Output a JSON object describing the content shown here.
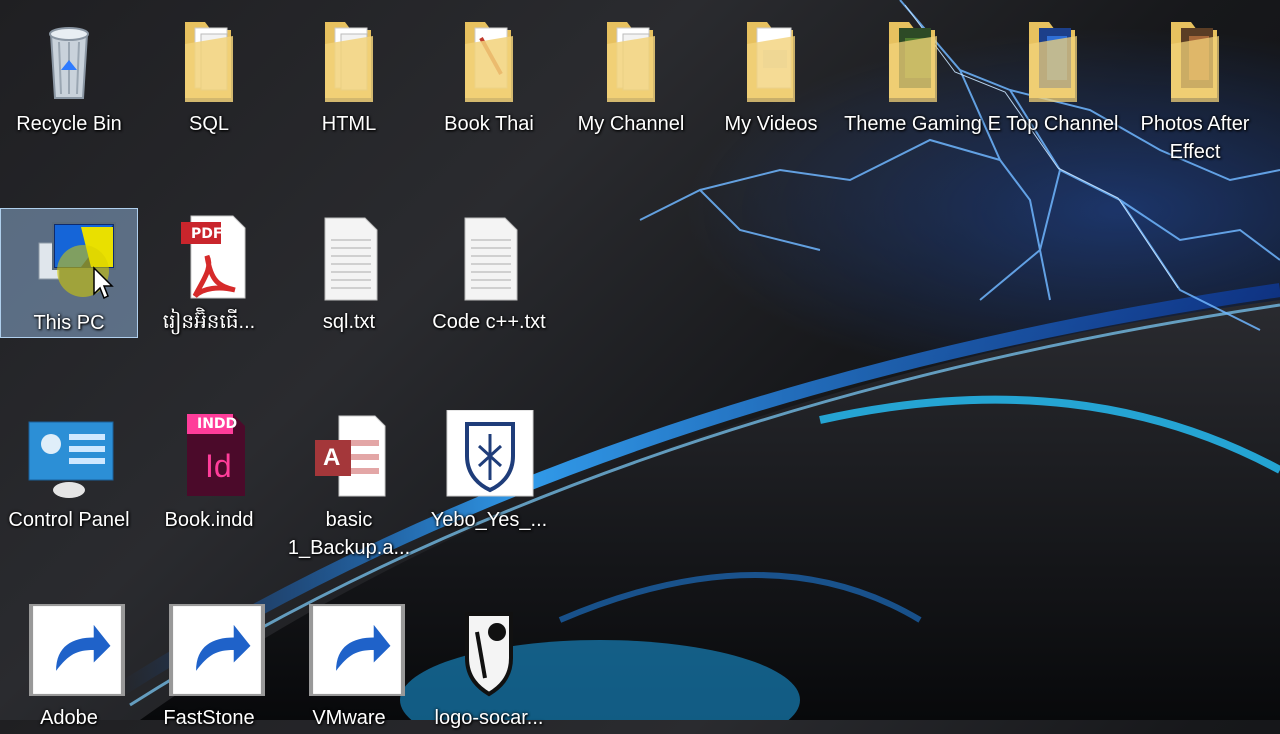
{
  "desktop": {
    "row1": [
      {
        "label": "Recycle Bin",
        "icon": "recycle-bin-icon"
      },
      {
        "label": "SQL",
        "icon": "folder-icon"
      },
      {
        "label": "HTML",
        "icon": "folder-icon"
      },
      {
        "label": "Book Thai",
        "icon": "folder-icon"
      },
      {
        "label": "My Channel",
        "icon": "folder-icon"
      },
      {
        "label": "My Videos",
        "icon": "folder-icon"
      },
      {
        "label": "Theme Gaming",
        "icon": "folder-icon"
      },
      {
        "label": "E Top Channel",
        "icon": "folder-icon"
      },
      {
        "label": "Photos After Effect",
        "icon": "folder-icon"
      }
    ],
    "row2": [
      {
        "label": "This PC",
        "icon": "computer-icon",
        "selected": true
      },
      {
        "label": "រៀនអ៊ិនធើ...",
        "icon": "pdf-file-icon"
      },
      {
        "label": "sql.txt",
        "icon": "text-file-icon"
      },
      {
        "label": "Code c++.txt",
        "icon": "text-file-icon"
      }
    ],
    "row3": [
      {
        "label": "Control Panel",
        "icon": "control-panel-icon"
      },
      {
        "label": "Book.indd",
        "icon": "indesign-file-icon",
        "badge": "INDD",
        "mark": "Id"
      },
      {
        "label": "basic 1_Backup.a...",
        "icon": "access-file-icon",
        "mark": "A"
      },
      {
        "label": "Yebo_Yes_...",
        "icon": "image-file-icon"
      }
    ],
    "row4": [
      {
        "label": "Adobe",
        "icon": "adobe-reader-icon"
      },
      {
        "label": "FastStone",
        "icon": "faststone-icon"
      },
      {
        "label": "VMware",
        "icon": "vmware-icon"
      },
      {
        "label": "logo-socar...",
        "icon": "image-file-icon"
      }
    ],
    "pdf_badge": "PDF",
    "colors": {
      "selection": "#a0c8f5",
      "folder": "#f2d27a",
      "accent_blue": "#2f7bff"
    }
  }
}
